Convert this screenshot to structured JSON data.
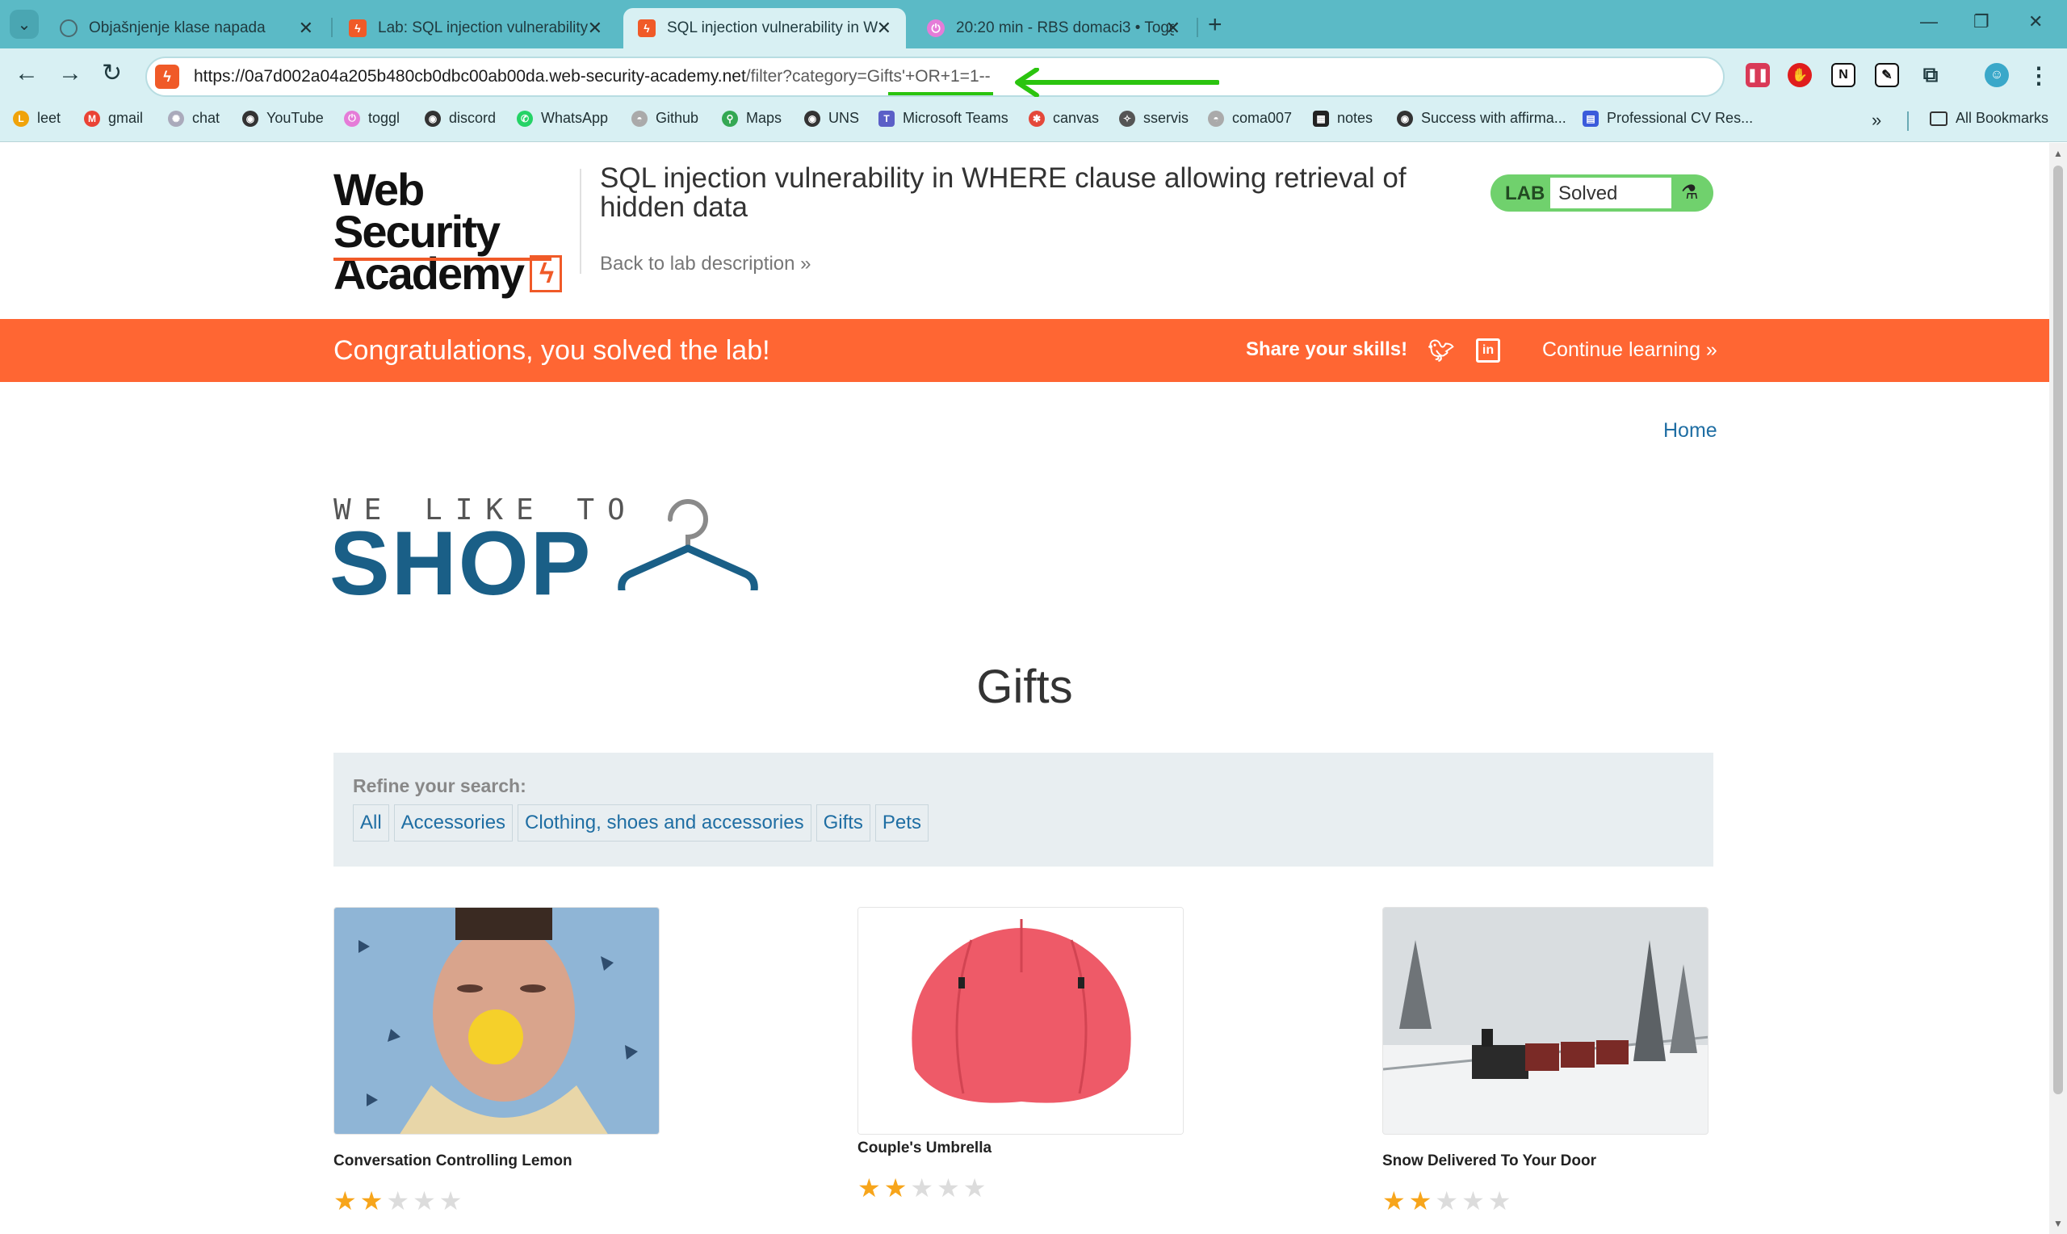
{
  "browser": {
    "tabs": [
      {
        "title": "Objašnjenje klase napada",
        "icon": "chatgpt-icon",
        "active": false
      },
      {
        "title": "Lab: SQL injection vulnerability",
        "icon": "portswigger-icon",
        "active": false
      },
      {
        "title": "SQL injection vulnerability in W",
        "icon": "portswigger-icon",
        "active": true
      },
      {
        "title": "20:20 min - RBS domaci3 • Toggl",
        "icon": "toggl-icon",
        "active": false
      }
    ],
    "url_main": "https://0a7d002a04a205b480cb0dbc00ab00da.web-security-academy.net",
    "url_path": "/filter?category=Gifts'+OR+1=1--",
    "bookmarks": [
      "leet",
      "gmail",
      "chat",
      "YouTube",
      "toggl",
      "discord",
      "WhatsApp",
      "Github",
      "Maps",
      "UNS",
      "Microsoft Teams",
      "canvas",
      "sservis",
      "coma007",
      "notes",
      "Success with affirma...",
      "Professional CV Res..."
    ],
    "all_bookmarks": "All Bookmarks",
    "annotation_color": "#2bc40f"
  },
  "header": {
    "logo_line1": "Web Security",
    "logo_line2": "Academy",
    "lab_title": "SQL injection vulnerability in WHERE clause allowing retrieval of hidden data",
    "back_link": "Back to lab description »",
    "lab_badge": "LAB",
    "lab_status": "Solved"
  },
  "banner": {
    "congrats": "Congratulations, you solved the lab!",
    "share": "Share your skills!",
    "continue": "Continue learning »",
    "color": "#ff6633"
  },
  "shop": {
    "home": "Home",
    "tagline": "WE LIKE TO",
    "name": "SHOP",
    "category": "Gifts",
    "refine_label": "Refine your search:",
    "filters": [
      "All",
      "Accessories",
      "Clothing, shoes and accessories",
      "Gifts",
      "Pets"
    ],
    "products": [
      {
        "name": "Conversation Controlling Lemon",
        "rating": 2
      },
      {
        "name": "Couple's Umbrella",
        "rating": 2
      },
      {
        "name": "Snow Delivered To Your Door",
        "rating": 2
      }
    ]
  }
}
